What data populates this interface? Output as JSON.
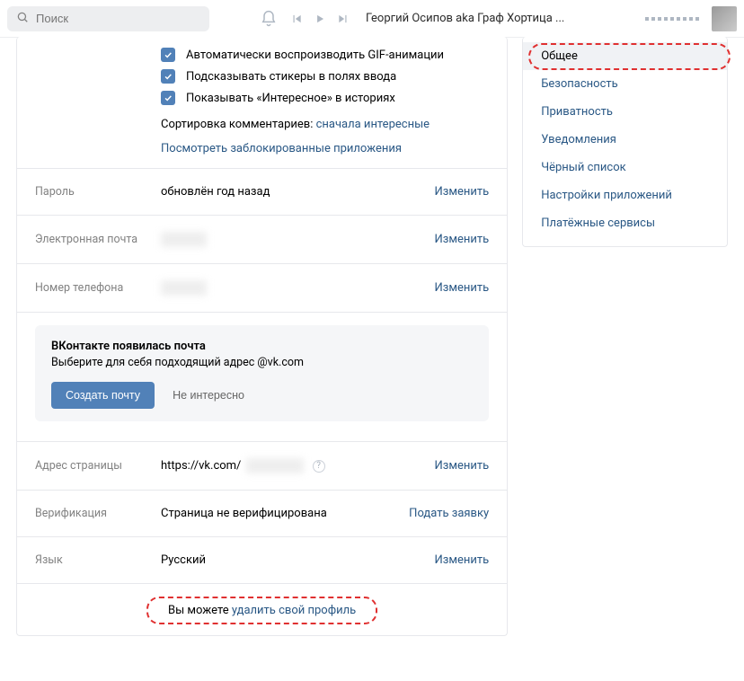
{
  "topbar": {
    "search_placeholder": "Поиск",
    "player_title": "Георгий Осипов aka Граф Хортица ..."
  },
  "settings_top": {
    "chk_gif": "Автоматически воспроизводить GIF-анимации",
    "chk_stickers": "Подсказывать стикеры в полях ввода",
    "chk_interesting": "Показывать «Интересное» в историях",
    "sort_label": "Сортировка комментариев: ",
    "sort_value": "сначала интересные",
    "blocked_apps": "Посмотреть заблокированные приложения"
  },
  "rows": {
    "password": {
      "label": "Пароль",
      "value": "обновлён год назад",
      "action": "Изменить"
    },
    "email": {
      "label": "Электронная почта",
      "action": "Изменить"
    },
    "phone": {
      "label": "Номер телефона",
      "action": "Изменить"
    },
    "address": {
      "label": "Адрес страницы",
      "prefix": "https://vk.com/",
      "action": "Изменить"
    },
    "verify": {
      "label": "Верификация",
      "value": "Страница не верифицирована",
      "action": "Подать заявку"
    },
    "lang": {
      "label": "Язык",
      "value": "Русский",
      "action": "Изменить"
    }
  },
  "promo": {
    "title": "ВКонтакте появилась почта",
    "subtitle": "Выберите для себя подходящий адрес @vk.com",
    "btn_create": "Создать почту",
    "btn_dismiss": "Не интересно"
  },
  "footer": {
    "prefix": "Вы можете ",
    "link": "удалить свой профиль"
  },
  "sidebar": {
    "items": [
      "Общее",
      "Безопасность",
      "Приватность",
      "Уведомления",
      "Чёрный список",
      "Настройки приложений",
      "Платёжные сервисы"
    ]
  }
}
